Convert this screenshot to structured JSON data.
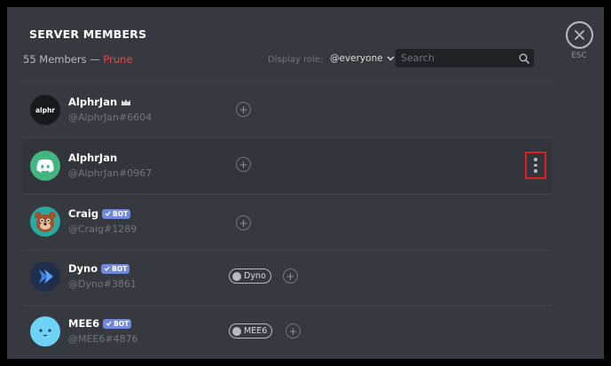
{
  "modal": {
    "title": "SERVER MEMBERS",
    "esc_label": "ESC"
  },
  "toolbar": {
    "member_count": "55 Members —",
    "prune_label": "Prune",
    "display_role_label": "Display role:",
    "role_value": "@everyone",
    "search_placeholder": "Search"
  },
  "members": [
    {
      "name": "AlphrJan",
      "tag": "@AlphrJan#6604",
      "avatar_text": "alphr",
      "owner": true
    },
    {
      "name": "AlphrJan",
      "tag": "@AlphrJan#0967",
      "avatar": "discord"
    },
    {
      "name": "Craig",
      "tag": "@Craig#1289",
      "bot": "BOT",
      "avatar": "craig"
    },
    {
      "name": "Dyno",
      "tag": "@Dyno#3861",
      "bot": "BOT",
      "avatar": "dyno",
      "role": "Dyno"
    },
    {
      "name": "MEE6",
      "tag": "@MEE6#4876",
      "bot": "BOT",
      "avatar": "mee6",
      "role": "MEE6"
    }
  ],
  "colors": {
    "background": "#36393f",
    "accent": "#7289da",
    "prune": "#f04747",
    "highlight_box": "#e01e1e"
  }
}
